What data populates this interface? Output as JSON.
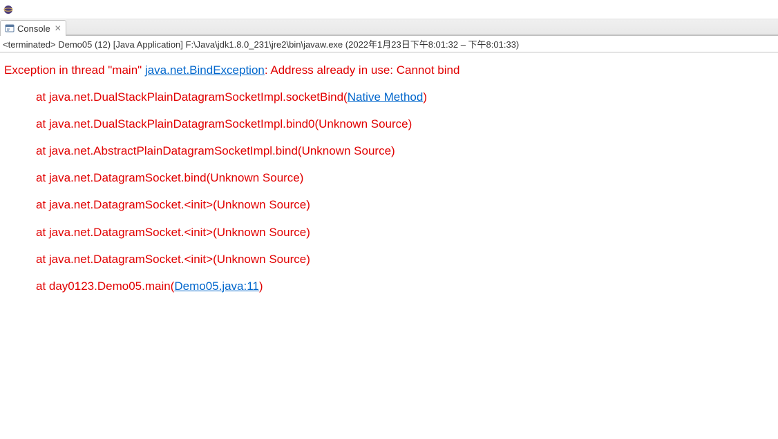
{
  "tab": {
    "label": "Console",
    "close_glyph": "✕"
  },
  "terminated": {
    "prefix": "<terminated>",
    "run_config": "Demo05 (12) [Java Application]",
    "path": "F:\\Java\\jdk1.8.0_231\\jre2\\bin\\javaw.exe",
    "time": "(2022年1月23日下午8:01:32 – 下午8:01:33)"
  },
  "exception": {
    "prefix": "Exception in thread \"main\" ",
    "class_link": "java.net.BindException",
    "message": ": Address already in use: Cannot bind"
  },
  "stack": [
    {
      "pre": "at java.net.DualStackPlainDatagramSocketImpl.socketBind(",
      "link": "Native Method",
      "post": ")"
    },
    {
      "pre": "at java.net.DualStackPlainDatagramSocketImpl.bind0(Unknown Source)",
      "link": "",
      "post": ""
    },
    {
      "pre": "at java.net.AbstractPlainDatagramSocketImpl.bind(Unknown Source)",
      "link": "",
      "post": ""
    },
    {
      "pre": "at java.net.DatagramSocket.bind(Unknown Source)",
      "link": "",
      "post": ""
    },
    {
      "pre": "at java.net.DatagramSocket.<init>(Unknown Source)",
      "link": "",
      "post": ""
    },
    {
      "pre": "at java.net.DatagramSocket.<init>(Unknown Source)",
      "link": "",
      "post": ""
    },
    {
      "pre": "at java.net.DatagramSocket.<init>(Unknown Source)",
      "link": "",
      "post": ""
    },
    {
      "pre": "at day0123.Demo05.main(",
      "link": "Demo05.java:11",
      "post": ")"
    }
  ]
}
